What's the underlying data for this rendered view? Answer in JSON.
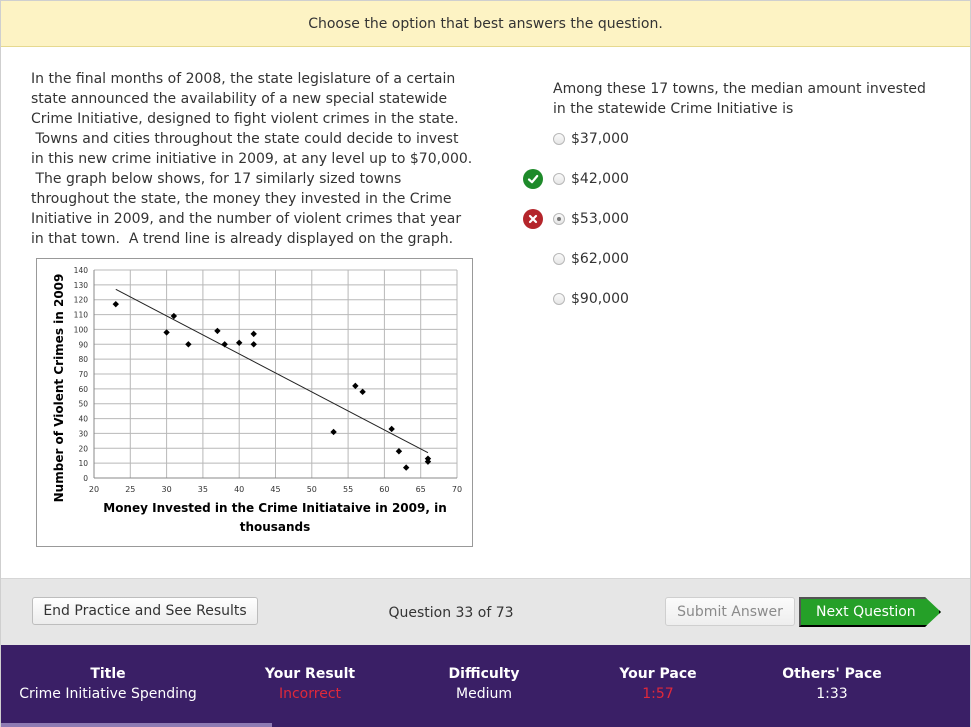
{
  "instruction": "Choose the option that best answers the question.",
  "passage_lines": [
    "In the final months of 2008, the state legislature of a certain",
    "state announced the availability of a new special statewide",
    "Crime Initiative, designed to fight violent crimes in the state.",
    " Towns and cities throughout the state could decide to invest",
    "in this new crime initiative in 2009, at any level up to $70,000.",
    " The graph below shows, for 17 similarly sized towns",
    "throughout the state, the money they invested in the Crime",
    "Initiative in 2009, and the number of violent crimes that year",
    "in that town.  A trend line is already displayed on the graph."
  ],
  "question": {
    "stem_lines": [
      "Among these 17 towns, the median amount invested",
      "in the statewide Crime Initiative is"
    ],
    "options": [
      {
        "label": "$37,000",
        "selected": false,
        "mark": ""
      },
      {
        "label": "$42,000",
        "selected": false,
        "mark": "correct"
      },
      {
        "label": "$53,000",
        "selected": true,
        "mark": "incorrect"
      },
      {
        "label": "$62,000",
        "selected": false,
        "mark": ""
      },
      {
        "label": "$90,000",
        "selected": false,
        "mark": ""
      }
    ]
  },
  "chart_data": {
    "type": "scatter",
    "title": "",
    "xlabel_lines": [
      "Money Invested in the Crime Initiataive in 2009, in",
      "thousands"
    ],
    "ylabel": "Number of Violent Crimes in 2009",
    "xlim": [
      20,
      70
    ],
    "ylim": [
      0,
      140
    ],
    "xticks": [
      20,
      25,
      30,
      35,
      40,
      45,
      50,
      55,
      60,
      65,
      70
    ],
    "yticks": [
      0,
      10,
      20,
      30,
      40,
      50,
      60,
      70,
      80,
      90,
      100,
      110,
      120,
      130,
      140
    ],
    "grid": true,
    "points": [
      {
        "x": 23,
        "y": 117
      },
      {
        "x": 30,
        "y": 98
      },
      {
        "x": 31,
        "y": 109
      },
      {
        "x": 33,
        "y": 90
      },
      {
        "x": 37,
        "y": 99
      },
      {
        "x": 38,
        "y": 90
      },
      {
        "x": 40,
        "y": 91
      },
      {
        "x": 42,
        "y": 97
      },
      {
        "x": 42,
        "y": 90
      },
      {
        "x": 53,
        "y": 31
      },
      {
        "x": 56,
        "y": 62
      },
      {
        "x": 57,
        "y": 58
      },
      {
        "x": 61,
        "y": 33
      },
      {
        "x": 62,
        "y": 18
      },
      {
        "x": 63,
        "y": 7
      },
      {
        "x": 66,
        "y": 13
      },
      {
        "x": 66,
        "y": 11
      }
    ],
    "trendline": {
      "x": [
        23,
        66
      ],
      "y": [
        127,
        17
      ]
    }
  },
  "actions": {
    "end_label": "End Practice and See Results",
    "counter": "Question 33 of 73",
    "submit_label": "Submit Answer",
    "next_label": "Next Question"
  },
  "footer": {
    "title_label": "Title",
    "title_value": "Crime Initiative Spending",
    "result_label": "Your Result",
    "result_value": "Incorrect",
    "difficulty_label": "Difficulty",
    "difficulty_value": "Medium",
    "pace_label": "Your Pace",
    "pace_value": "1:57",
    "others_label": "Others' Pace",
    "others_value": "1:33"
  },
  "colors": {
    "correct": "#1e8a2a",
    "incorrect": "#b4252b",
    "next_button": "#25a028",
    "footer_bg": "#3a1f66",
    "instruction_bg": "#fdf3c4"
  }
}
